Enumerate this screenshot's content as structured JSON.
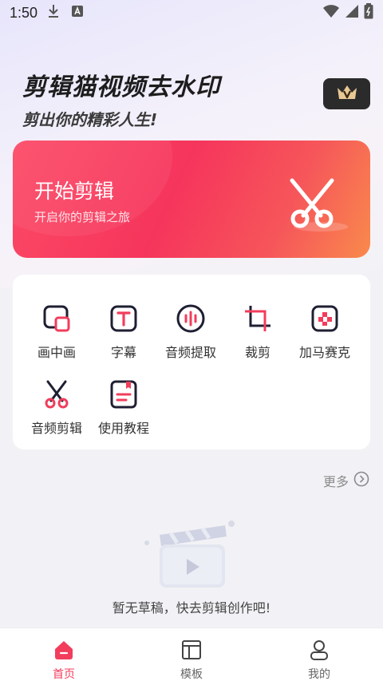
{
  "status_bar": {
    "time": "1:50"
  },
  "header": {
    "title": "剪辑猫视频去水印",
    "subtitle": "剪出你的精彩人生!",
    "vip_icon": "crown-v-icon"
  },
  "hero": {
    "title": "开始剪辑",
    "subtitle": "开启你的剪辑之旅",
    "icon": "scissors-icon",
    "gradient_start": "#fc4a66",
    "gradient_end": "#f98a4c"
  },
  "tools": [
    {
      "label": "画中画",
      "icon": "picture-in-picture-icon"
    },
    {
      "label": "字幕",
      "icon": "subtitle-icon"
    },
    {
      "label": "音频提取",
      "icon": "audio-extract-icon"
    },
    {
      "label": "裁剪",
      "icon": "crop-icon"
    },
    {
      "label": "加马赛克",
      "icon": "mosaic-icon"
    },
    {
      "label": "音频剪辑",
      "icon": "audio-cut-icon"
    },
    {
      "label": "使用教程",
      "icon": "tutorial-icon"
    }
  ],
  "more": {
    "label": "更多"
  },
  "drafts": {
    "empty_text": "暂无草稿，快去剪辑创作吧!"
  },
  "bottom_nav": [
    {
      "label": "首页",
      "icon": "home-icon",
      "active": true
    },
    {
      "label": "模板",
      "icon": "template-icon",
      "active": false
    },
    {
      "label": "我的",
      "icon": "profile-icon",
      "active": false
    }
  ],
  "colors": {
    "accent": "#f23d5c",
    "icon_dark": "#1f1f33",
    "icon_pink": "#f23d5c"
  }
}
